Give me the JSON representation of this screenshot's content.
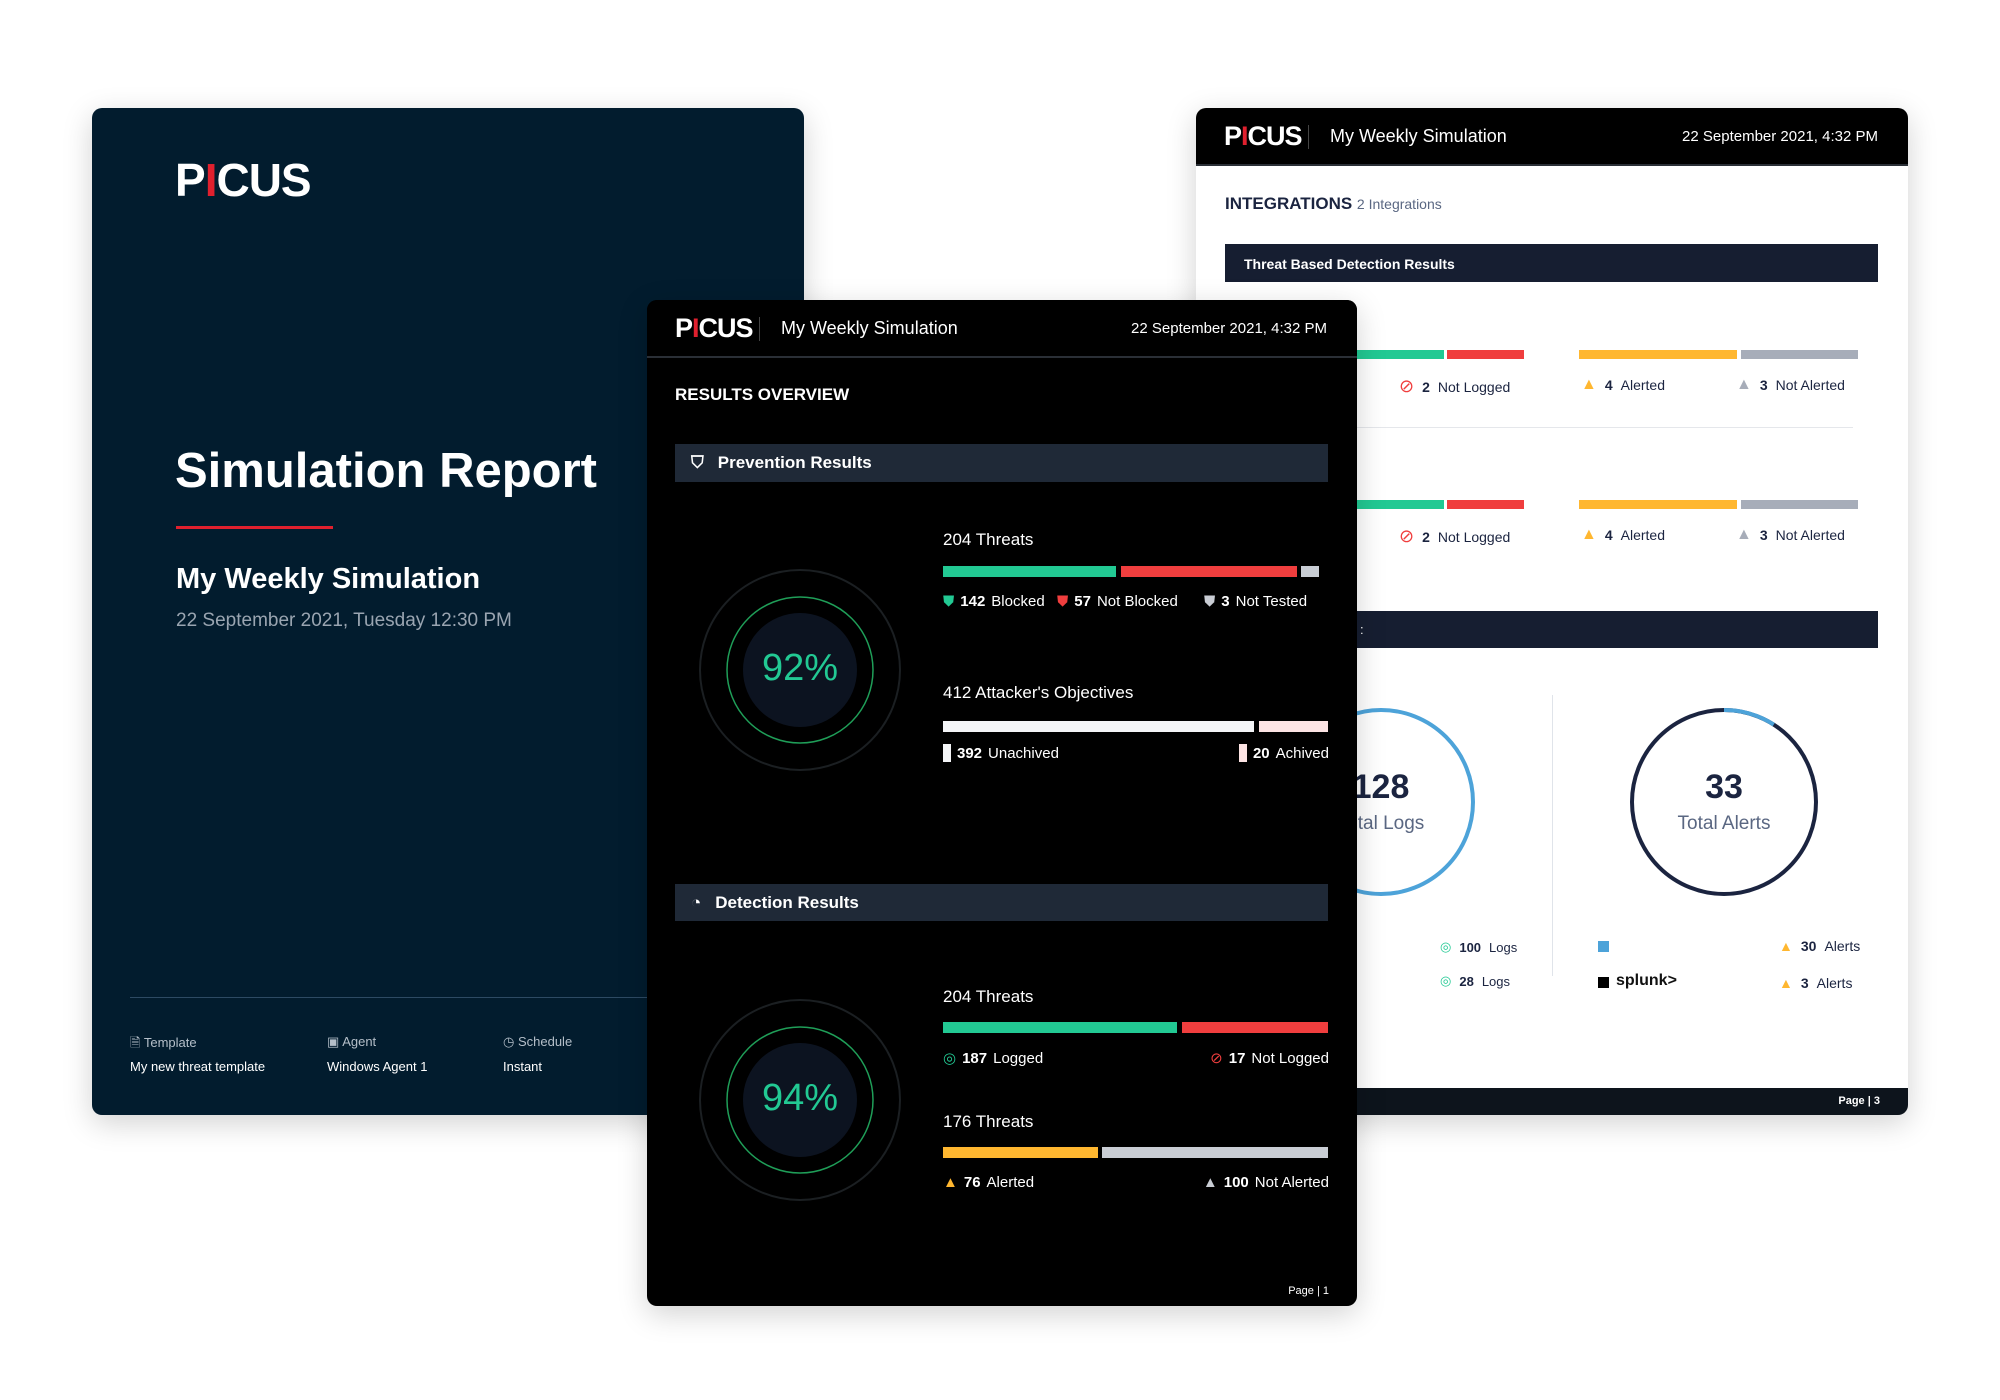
{
  "brand": {
    "logo": "PICUS",
    "accent": "#e0202e"
  },
  "cover": {
    "title": "Simulation Report",
    "subtitle": "My Weekly Simulation",
    "date": "22 September 2021, Tuesday 12:30 PM",
    "meta": [
      {
        "icon": "document-icon",
        "label": "Template",
        "value": "My new threat template"
      },
      {
        "icon": "agent-icon",
        "label": "Agent",
        "value": "Windows Agent 1"
      },
      {
        "icon": "clock-icon",
        "label": "Schedule",
        "value": "Instant"
      }
    ]
  },
  "header": {
    "title": "My Weekly Simulation",
    "date": "22 September 2021, 4:32 PM"
  },
  "overview": {
    "heading": "RESULTS OVERVIEW",
    "page": "Page",
    "page_num": "1",
    "prevention": {
      "title": "Prevention Results",
      "score": "92%",
      "score_value": 92,
      "threats": {
        "label": "204 Threats",
        "blocked": "142",
        "blocked_label": "Blocked",
        "not_blocked": "57",
        "not_blocked_label": "Not Blocked",
        "not_tested": "3",
        "not_tested_label": "Not Tested"
      },
      "objectives": {
        "label": "412 Attacker's Objectives",
        "unachieved": "392",
        "unachieved_label": "Unachived",
        "achieved": "20",
        "achieved_label": "Achived"
      }
    },
    "detection": {
      "title": "Detection Results",
      "score": "94%",
      "score_value": 94,
      "logs": {
        "label": "204 Threats",
        "logged": "187",
        "logged_label": "Logged",
        "not_logged": "17",
        "not_logged_label": "Not Logged"
      },
      "alerts": {
        "label": "176 Threats",
        "alerted": "76",
        "alerted_label": "Alerted",
        "not_alerted": "100",
        "not_alerted_label": "Not Alerted"
      }
    }
  },
  "integrations": {
    "heading": "INTEGRATIONS",
    "count": "2 Integrations",
    "section1": "Threat Based Detection Results",
    "section2": ":",
    "page": "Page",
    "page_num": "3",
    "rows": [
      {
        "not_logged": "2",
        "not_logged_label": "Not Logged",
        "alerted": "4",
        "alerted_label": "Alerted",
        "not_alerted": "3",
        "not_alerted_label": "Not Alerted"
      },
      {
        "not_logged": "2",
        "not_logged_label": "Not Logged",
        "alerted": "4",
        "alerted_label": "Alerted",
        "not_alerted": "3",
        "not_alerted_label": "Not Alerted"
      }
    ],
    "logs_total": "128",
    "logs_total_label": "Total Logs",
    "alerts_total": "33",
    "alerts_total_label": "Total Alerts",
    "logs": [
      {
        "value": "100",
        "label": "Logs"
      },
      {
        "value": "28",
        "label": "Logs"
      }
    ],
    "alerts": [
      {
        "value": "30",
        "label": "Alerts"
      },
      {
        "value": "3",
        "label": "Alerts"
      }
    ],
    "vendors": [
      {
        "name": "",
        "color": "#4da3d9"
      },
      {
        "name": "splunk>",
        "color": "#000000"
      }
    ]
  },
  "colors": {
    "green": "#22c993",
    "red": "#f03e3e",
    "gray": "#c9cdd4",
    "yellow": "#ffb730",
    "pink": "#fde4e4",
    "navy": "#1b2440",
    "blue": "#4da3d9"
  }
}
